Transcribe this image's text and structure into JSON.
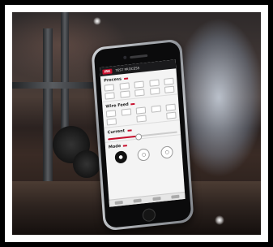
{
  "app": {
    "logo_text": "IRK",
    "title": "TEST PROCESS",
    "accent_color": "#c8102e"
  },
  "sections": [
    {
      "title": "Process"
    },
    {
      "title": "Wire Feed"
    },
    {
      "title": "Current"
    },
    {
      "title": "Mode"
    }
  ],
  "mode_buttons": [
    {
      "icon": "circle-dot-icon",
      "glyph": "●",
      "active": true
    },
    {
      "icon": "circle-icon",
      "glyph": "○",
      "active": false
    },
    {
      "icon": "circle-icon",
      "glyph": "○",
      "active": false
    }
  ]
}
